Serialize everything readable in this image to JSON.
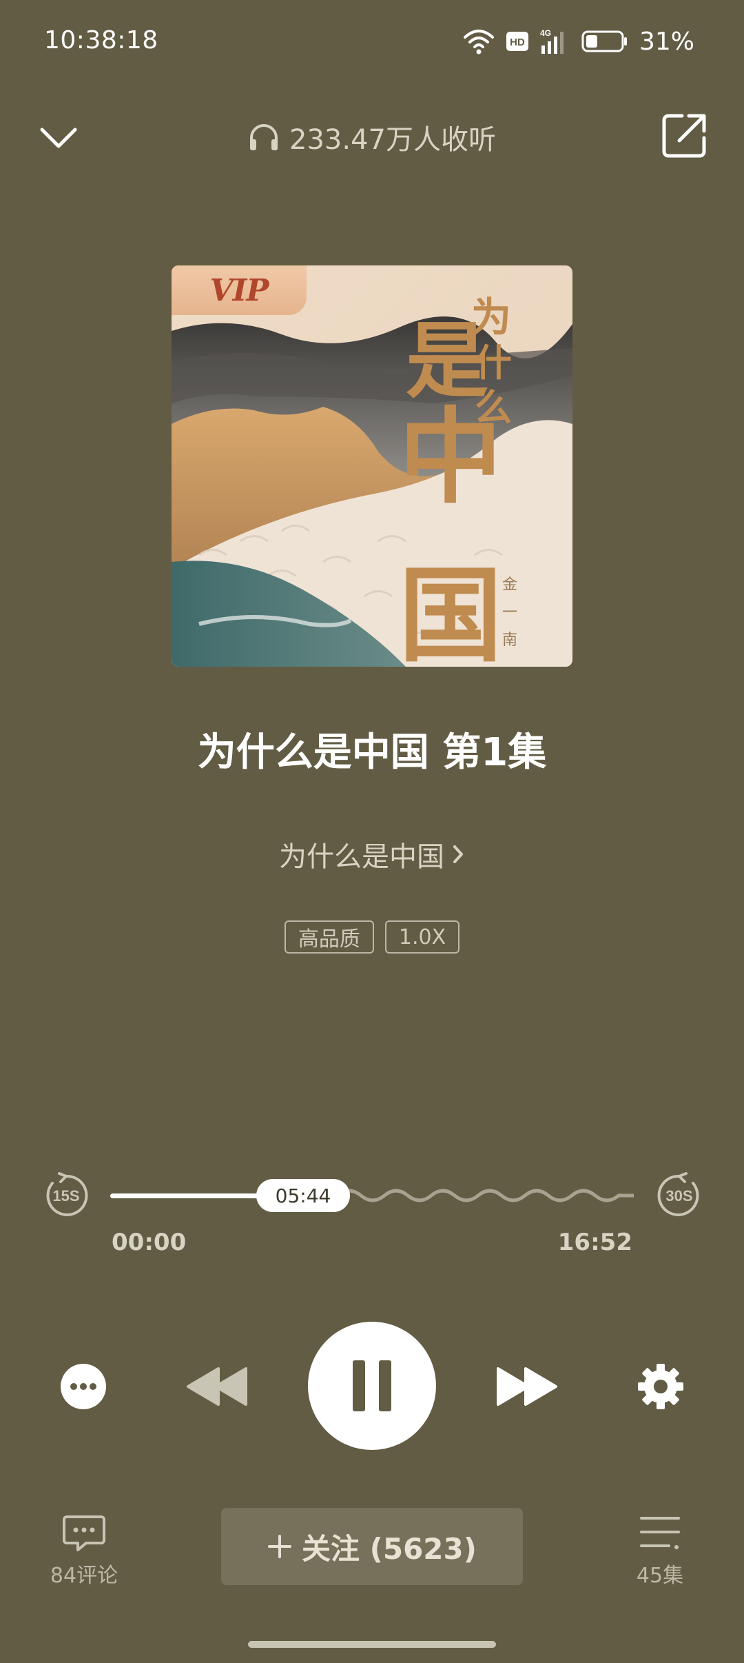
{
  "status_bar": {
    "time": "10:38:18",
    "battery": "31%"
  },
  "header": {
    "listen_count": "233.47万人收听"
  },
  "cover": {
    "vip_label": "VIP"
  },
  "episode": {
    "title": "为什么是中国 第1集",
    "album": "为什么是中国"
  },
  "tags": {
    "quality": "高品质",
    "speed": "1.0X"
  },
  "progress": {
    "current": "05:44",
    "start": "00:00",
    "end": "16:52",
    "fraction": 0.34
  },
  "bottom": {
    "comments": "84评论",
    "follow": "关注 (5623)",
    "episodes": "45集"
  },
  "icons": {
    "back": "chevron-down-icon",
    "share": "share-icon",
    "headphones": "headphones-icon",
    "rewind15": "rewind-15s-icon",
    "forward30": "forward-30s-icon",
    "more": "more-icon",
    "prev": "rewind-icon",
    "pause": "pause-icon",
    "next": "fast-forward-icon",
    "settings": "gear-icon",
    "comment": "comment-icon",
    "playlist": "playlist-icon"
  },
  "colors": {
    "background": "#625c44",
    "accent": "#ffffff",
    "cover_gold": "#b88a4f"
  }
}
